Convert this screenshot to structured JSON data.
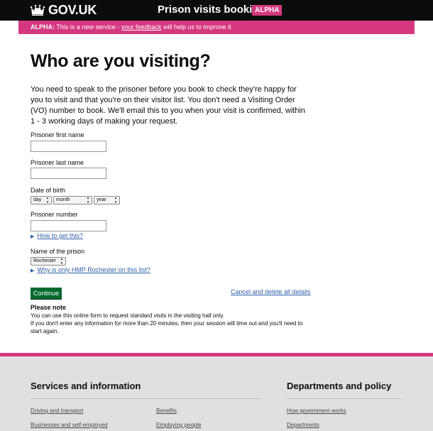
{
  "header": {
    "logo_text": "GOV.UK",
    "service_name": "Prison visits booking",
    "phase_tag": "ALPHA"
  },
  "banner": {
    "phase": "ALPHA:",
    "text_before": "This is a new service -",
    "link": "your feedback",
    "text_after": "will help us to improve it"
  },
  "main": {
    "heading": "Who are you visiting?",
    "intro": "You need to speak to the prisoner before you book to check they're happy for you to visit and that you're on their visitor list. You don't need a Visiting Order (VO) number to book. We'll email this to you when your visit is confirmed, within 1 - 3 working days of making your request.",
    "fields": {
      "first_name_label": "Prisoner first name",
      "first_name_value": "",
      "last_name_label": "Prisoner last name",
      "last_name_value": "",
      "dob_label": "Date of birth",
      "dob_day": "day",
      "dob_month": "month",
      "dob_year": "year",
      "number_label": "Prisoner number",
      "number_value": "",
      "number_help": "How to get this?",
      "prison_label": "Name of the prison",
      "prison_value": "Rochester",
      "prison_help": "Why is only HMP Rochester on this list?"
    },
    "continue_label": "Continue",
    "cancel_label": "Cancel and delete all details",
    "note_title": "Please note",
    "note_line1": "You can use this online form to request standard visits in the visiting hall only.",
    "note_line2": "If you don't enter any information for more than 20 minutes, then your session will time out and you'll need to start again."
  },
  "footer": {
    "col1_title": "Services and information",
    "col1_links": [
      "Driving and transport",
      "Businesses and self-employed"
    ],
    "col2_links": [
      "Benefits",
      "Employing people"
    ],
    "col3_title": "Departments and policy",
    "col3_links": [
      "How government works",
      "Departments"
    ]
  },
  "colors": {
    "header_bg": "#0b0c0c",
    "alpha_pink": "#d53880",
    "button_green": "#00692f",
    "link_blue": "#2b5ea7",
    "footer_bg": "#dee0e2"
  }
}
